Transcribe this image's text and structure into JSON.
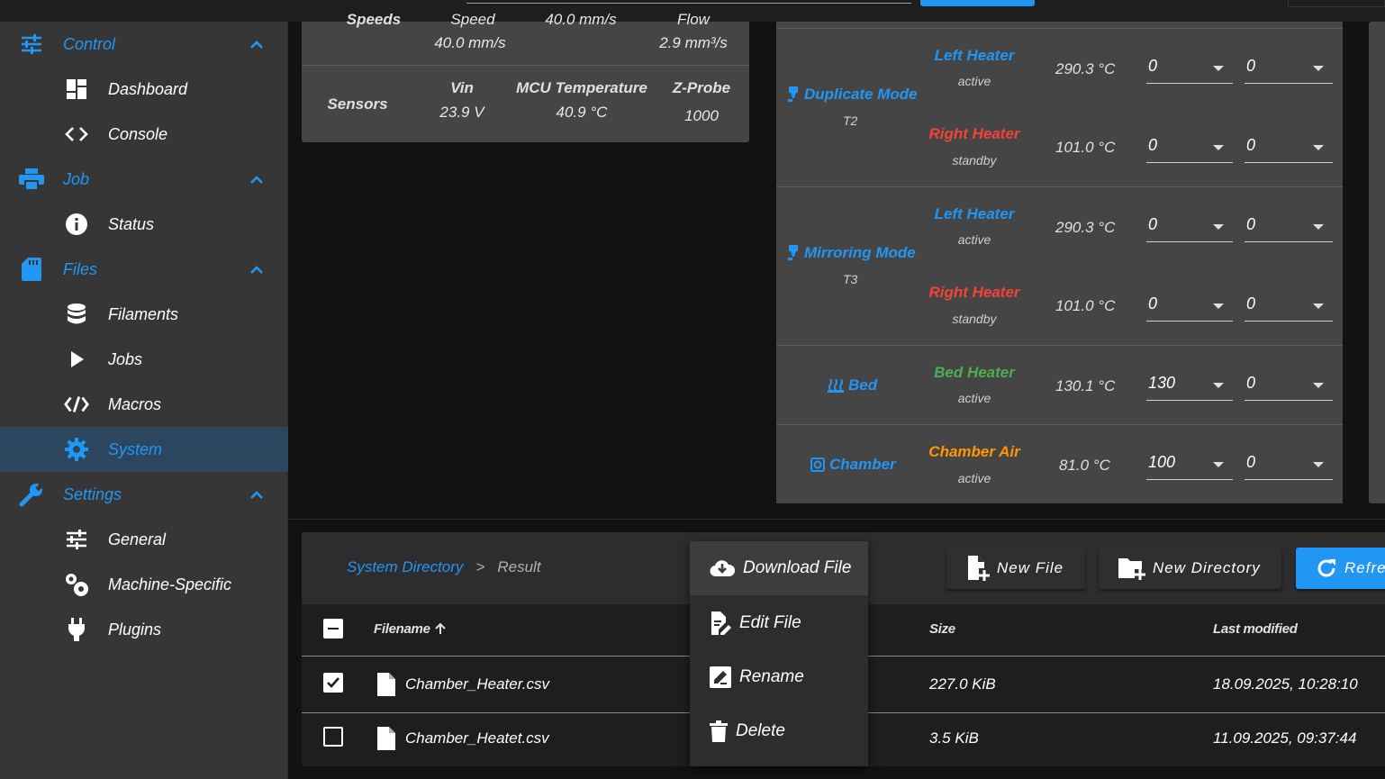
{
  "sidebar": {
    "groups": [
      {
        "label": "Control",
        "icon": "tune-icon",
        "items": [
          {
            "label": "Dashboard",
            "icon": "dashboard-icon"
          },
          {
            "label": "Console",
            "icon": "code-brackets-icon"
          }
        ]
      },
      {
        "label": "Job",
        "icon": "printer-icon",
        "items": [
          {
            "label": "Status",
            "icon": "info-icon"
          }
        ]
      },
      {
        "label": "Files",
        "icon": "sd-card-icon",
        "items": [
          {
            "label": "Filaments",
            "icon": "database-icon"
          },
          {
            "label": "Jobs",
            "icon": "play-icon"
          },
          {
            "label": "Macros",
            "icon": "code-slash-icon"
          },
          {
            "label": "System",
            "icon": "gear-icon",
            "active": true
          }
        ]
      },
      {
        "label": "Settings",
        "icon": "wrench-icon",
        "items": [
          {
            "label": "General",
            "icon": "sliders-icon"
          },
          {
            "label": "Machine-Specific",
            "icon": "gears-icon"
          },
          {
            "label": "Plugins",
            "icon": "plug-icon"
          }
        ]
      }
    ]
  },
  "status": {
    "speeds_label": "Speeds",
    "speed_head": "Speed",
    "speed_value": "40.0 mm/s",
    "flow_head": "Flow",
    "flow_value": "2.9 mm³/s",
    "top_middle_value": "40.0 mm/s",
    "sensors_label": "Sensors",
    "vin_head": "Vin",
    "vin_value": "23.9 V",
    "mcu_head": "MCU Temperature",
    "mcu_value": "40.9 °C",
    "zprobe_head": "Z-Probe",
    "zprobe_value": "1000"
  },
  "heaters": {
    "duplicate": {
      "tool": "Duplicate Mode",
      "sub": "T2",
      "left": {
        "name": "Left Heater",
        "state": "active",
        "temp": "290.3 °C",
        "active": "0",
        "standby": "0"
      },
      "right": {
        "name": "Right Heater",
        "state": "standby",
        "temp": "101.0 °C",
        "active": "0",
        "standby": "0"
      }
    },
    "mirroring": {
      "tool": "Mirroring Mode",
      "sub": "T3",
      "left": {
        "name": "Left Heater",
        "state": "active",
        "temp": "290.3 °C",
        "active": "0",
        "standby": "0"
      },
      "right": {
        "name": "Right Heater",
        "state": "standby",
        "temp": "101.0 °C",
        "active": "0",
        "standby": "0"
      }
    },
    "bed": {
      "tool": "Bed",
      "name": "Bed Heater",
      "state": "active",
      "temp": "130.1 °C",
      "active": "130",
      "standby": "0"
    },
    "chamber": {
      "tool": "Chamber",
      "name": "Chamber Air",
      "state": "active",
      "temp": "81.0 °C",
      "active": "100",
      "standby": "0"
    },
    "colors": {
      "blue": "#2196f3",
      "red": "#f44336",
      "green": "#4caf50",
      "orange": "#ff9800"
    }
  },
  "files": {
    "breadcrumb": {
      "root": "System Directory",
      "sep": ">",
      "current": "Result"
    },
    "toolbar": {
      "new_file": "New File",
      "new_directory": "New Directory",
      "refresh": "Refre"
    },
    "columns": {
      "filename": "Filename",
      "size": "Size",
      "modified": "Last modified"
    },
    "rows": [
      {
        "name": "Chamber_Heater.csv",
        "size": "227.0 KiB",
        "modified": "18.09.2025, 10:28:10",
        "checked": true
      },
      {
        "name": "Chamber_Heatet.csv",
        "size": "3.5 KiB",
        "modified": "11.09.2025, 09:37:44",
        "checked": false
      }
    ]
  },
  "context_menu": {
    "download": "Download File",
    "edit": "Edit File",
    "rename": "Rename",
    "delete": "Delete"
  }
}
